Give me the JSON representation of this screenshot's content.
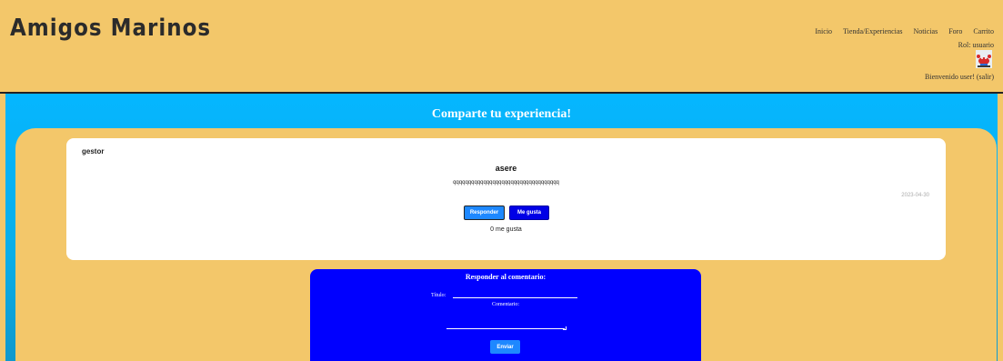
{
  "site": {
    "logo": "Amigos Marinos"
  },
  "nav": {
    "items": [
      "Inicio",
      "Tienda/Experiencias",
      "Noticias",
      "Foro",
      "Carrito"
    ]
  },
  "user": {
    "role_text": "Rol: usuario",
    "welcome_text": "Bienvenido user! (salir)",
    "avatar_icon": "crab-avatar-icon"
  },
  "banner": {
    "title": "Comparte tu experiencia!"
  },
  "comment": {
    "author": "gestor",
    "title": "asere",
    "body": "qqqqqqqqqqqqqqqqqqqqqqqqqqqqqqqqqqq",
    "date": "2023-04-30",
    "reply_label": "Responder",
    "like_label": "Me gusta",
    "likes_text": "0 me gusta"
  },
  "reply_form": {
    "title": "Responder al comentario:",
    "title_label": "Título:",
    "title_value": "",
    "comment_label": "Comentario:",
    "comment_value": "",
    "submit_label": "Enviar"
  },
  "colors": {
    "sand": "#f3c76a",
    "sky": "#05b6ff",
    "form_blue": "#0000ff",
    "button_blue": "#1e88ff"
  }
}
